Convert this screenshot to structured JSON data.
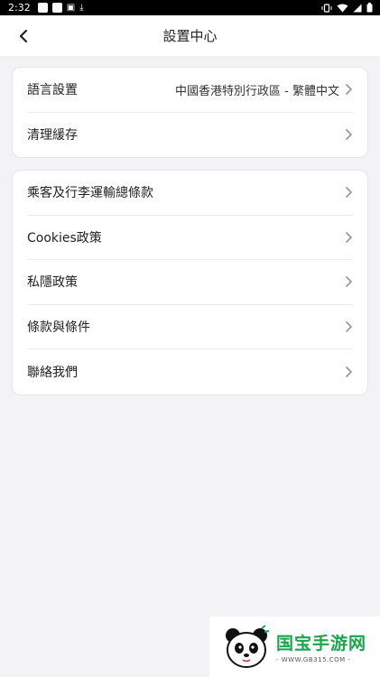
{
  "status_bar": {
    "time": "2:32"
  },
  "header": {
    "title": "設置中心"
  },
  "settings_group": [
    {
      "name": "language",
      "label": "語言設置",
      "value": "中國香港特別行政區 - 繁體中文"
    },
    {
      "name": "clear-cache",
      "label": "清理緩存"
    }
  ],
  "info_group": [
    {
      "name": "passenger-baggage",
      "label": "乘客及行李運輸總條款"
    },
    {
      "name": "cookies-policy",
      "label": "Cookies政策"
    },
    {
      "name": "privacy-policy",
      "label": "私隱政策"
    },
    {
      "name": "terms-conditions",
      "label": "條款與條件"
    },
    {
      "name": "contact-us",
      "label": "聯絡我們"
    }
  ],
  "watermark": {
    "title": "国宝手游网",
    "url": "- WWW.GB315.COM -"
  },
  "colors": {
    "background": "#f3f3f5",
    "card": "#ffffff",
    "chevron": "#9a9a9a",
    "watermark_green": "#1aa64a"
  }
}
